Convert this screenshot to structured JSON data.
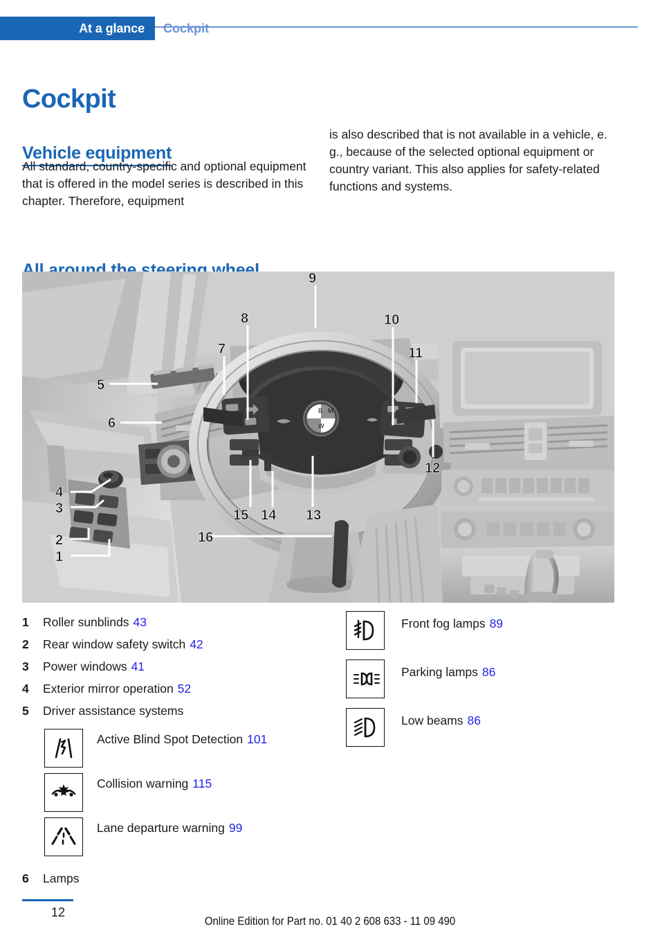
{
  "header": {
    "tab_label": "At a glance",
    "section_label": "Cockpit",
    "tab_color": "#1a66b5",
    "section_color": "#6b94d6"
  },
  "chapter": {
    "title": "Cockpit",
    "title_color": "#1a66b5"
  },
  "sections": {
    "vehicle_equipment": {
      "heading": "Vehicle equipment",
      "paragraph_left": "All standard, country-specific and optional equipment that is offered in the model series is described in this chapter. Therefore, equipment",
      "paragraph_right": "is also described that is not available in a vehicle, e. g., because of the selected optional equipment or country variant. This also applies for safety-related functions and systems."
    },
    "steering_wheel": {
      "heading": "All around the steering wheel"
    }
  },
  "figure": {
    "name": "cockpit-illustration",
    "callouts": [
      "1",
      "2",
      "3",
      "4",
      "5",
      "6",
      "7",
      "8",
      "9",
      "10",
      "11",
      "12",
      "13",
      "14",
      "15",
      "16"
    ]
  },
  "legend_left": [
    {
      "num": "1",
      "label": "Roller sunblinds",
      "page": "43"
    },
    {
      "num": "2",
      "label": "Rear window safety switch",
      "page": "42"
    },
    {
      "num": "3",
      "label": "Power windows",
      "page": "41"
    },
    {
      "num": "4",
      "label": "Exterior mirror operation",
      "page": "52"
    },
    {
      "num": "5",
      "label": "Driver assistance systems",
      "page": ""
    }
  ],
  "driver_assistance_icons": [
    {
      "icon": "active-blind-spot-detection-icon",
      "label": "Active Blind Spot Detection",
      "page": "101"
    },
    {
      "icon": "collision-warning-icon",
      "label": "Collision warning",
      "page": "115"
    },
    {
      "icon": "lane-departure-warning-icon",
      "label": "Lane departure warning",
      "page": "99"
    }
  ],
  "lamps_item": {
    "num": "6",
    "label": "Lamps"
  },
  "lamp_icons": [
    {
      "icon": "front-fog-lamps-icon",
      "label": "Front fog lamps",
      "page": "89"
    },
    {
      "icon": "parking-lamps-icon",
      "label": "Parking lamps",
      "page": "86"
    },
    {
      "icon": "low-beams-icon",
      "label": "Low beams",
      "page": "86"
    }
  ],
  "footer": {
    "page_number": "12",
    "note": "Online Edition for Part no. 01 40 2 608 633 - 11 09 490"
  },
  "colors": {
    "heading_blue": "#1a66b5",
    "pageref_blue": "#2323e8",
    "header_light_blue": "#6b94d6"
  }
}
